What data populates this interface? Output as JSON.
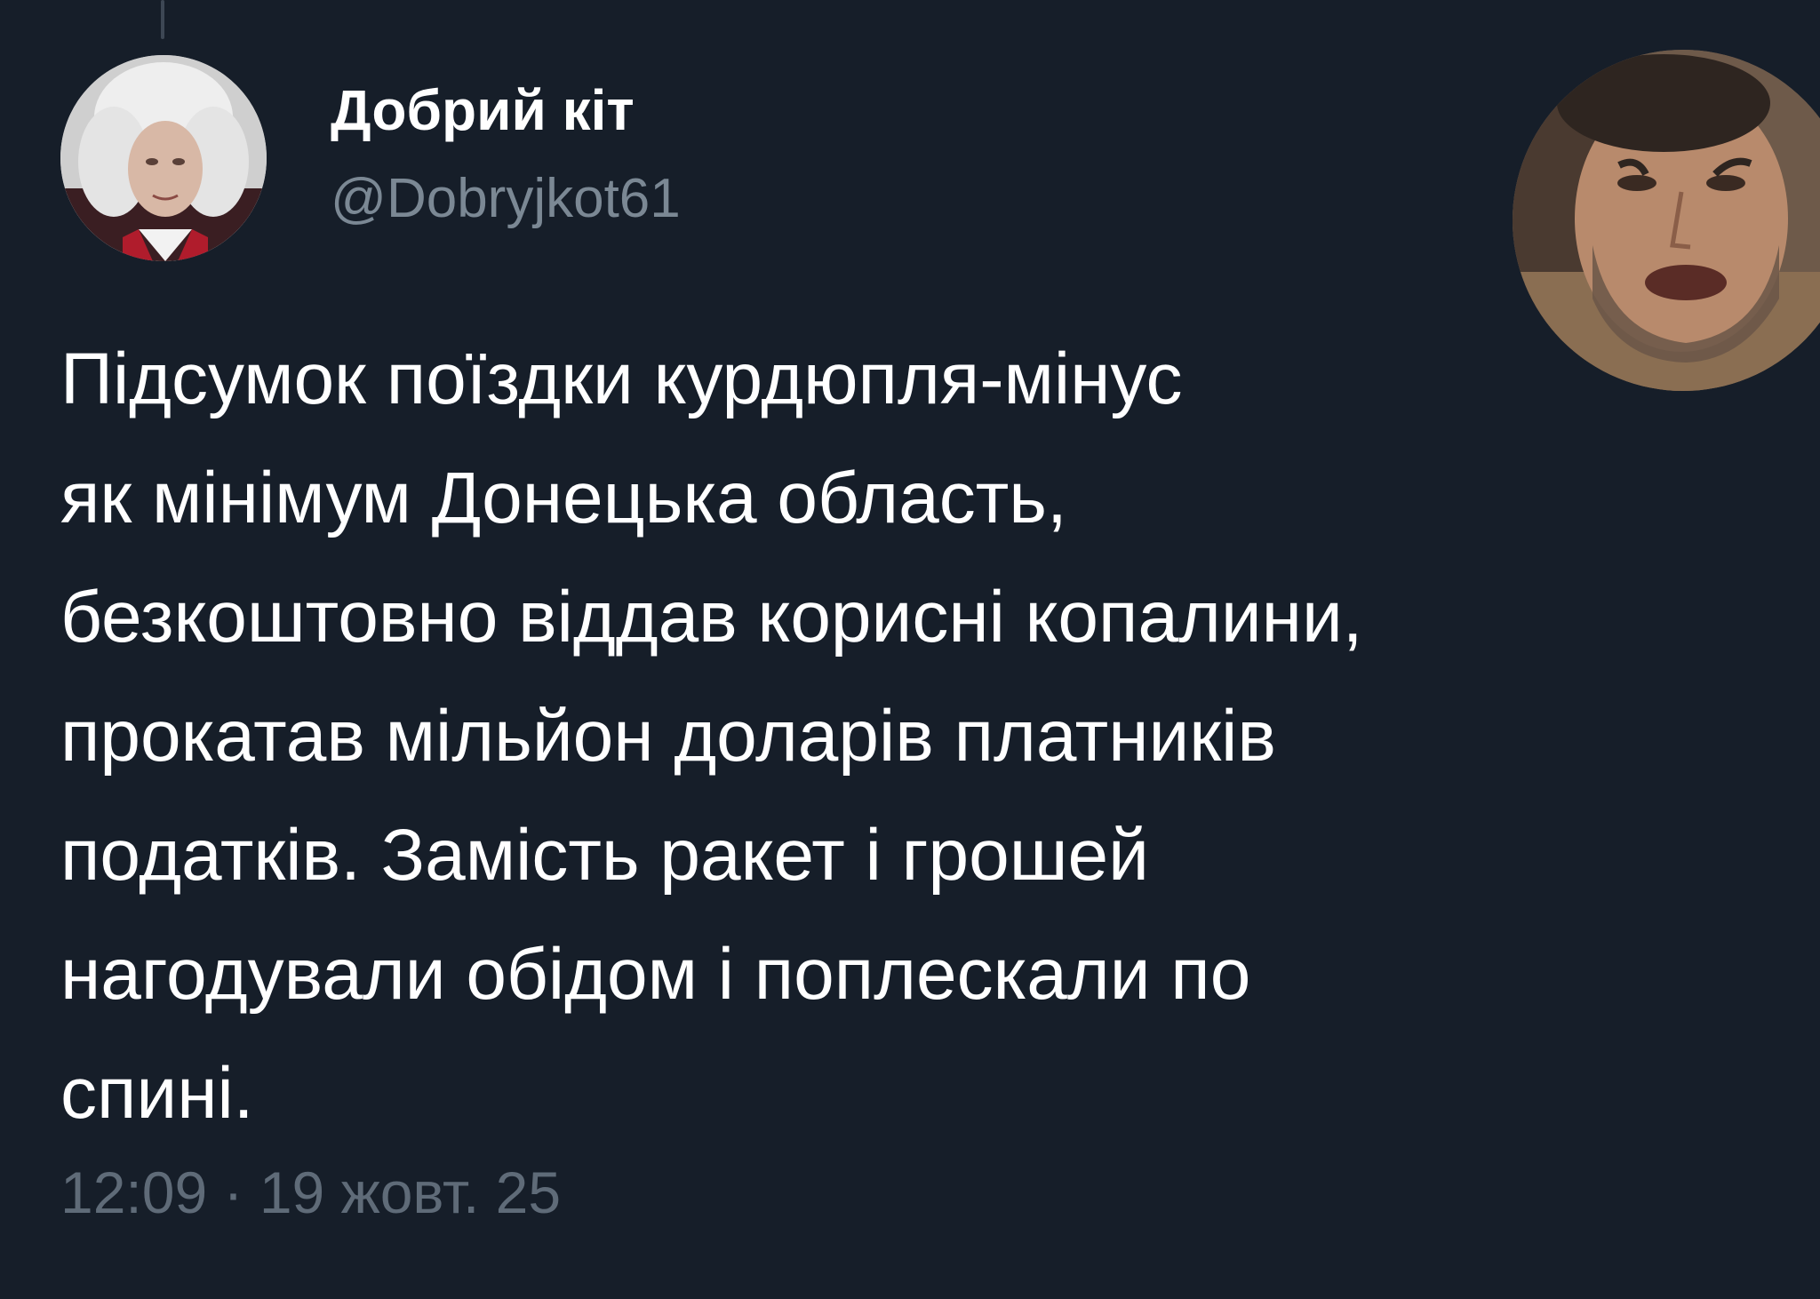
{
  "tweet": {
    "author": {
      "display_name": "Добрий кіт",
      "handle": "@Dobryjkot61"
    },
    "text_lines": [
      "Підсумок поїздки курдюпля-мінус",
      "як мінімум Донецька область,",
      "безкоштовно віддав корисні копалини,",
      "прокатав мільйон доларів платників",
      "податків. Замість ракет і грошей",
      "нагодували обідом і поплескали по",
      "спині."
    ],
    "timestamp": "12:09 · 19 жовт. 25"
  },
  "colors": {
    "background": "#161e29",
    "text": "#ffffff",
    "secondary": "#7b8894",
    "timestamp": "#5f6b78",
    "thread_line": "#3d4754"
  }
}
